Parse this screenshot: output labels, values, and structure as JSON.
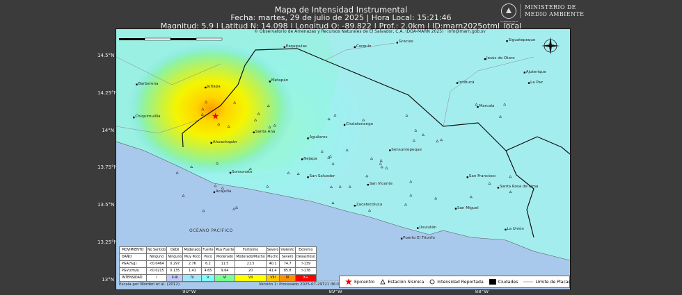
{
  "header": {
    "title": "Mapa de Intensidad Instrumental",
    "line2": "Fecha: martes, 29 de julio de 2025 | Hora Local: 15:21:46",
    "line3": "Magnitud: 5.9 | Latitud N: 14.098 | Longitud O: -89.822 | Prof.: 2.0km | ID:marn2025otml_local"
  },
  "logo": {
    "seal_text": "GOBIERNO DE EL SALVADOR",
    "line1": "MINISTERIO DE",
    "line2": "MEDIO AMBIENTE"
  },
  "map": {
    "copyright": "© Observatorio de Amenazas y Recursos Naturales de El Salvador, C.A. (DOA-MARN 2025) · info@marn.gob.sv",
    "scale_unit": "km",
    "ocean_label": "OCÉANO PACÍFICO",
    "lat_labels": [
      "14.5°N",
      "14.25°N",
      "14°N",
      "13.75°N",
      "13.5°N",
      "13.25°N",
      "13°N"
    ],
    "lon_labels": [
      "90°W",
      "89°W",
      "88°W"
    ],
    "epicenter": {
      "lat": 14.098,
      "lon": -89.822
    },
    "cities": [
      {
        "name": "Esquipulas",
        "lat": 14.56,
        "lon": -89.35
      },
      {
        "name": "Gracias",
        "lat": 14.59,
        "lon": -88.58
      },
      {
        "name": "Siguatepeque",
        "lat": 14.6,
        "lon": -87.83
      },
      {
        "name": "Corquín",
        "lat": 14.56,
        "lon": -88.87
      },
      {
        "name": "Jesús de Otoro",
        "lat": 14.48,
        "lon": -87.98
      },
      {
        "name": "Ajuterique",
        "lat": 14.39,
        "lon": -87.71
      },
      {
        "name": "La Paz",
        "lat": 14.32,
        "lon": -87.68
      },
      {
        "name": "Intibucá",
        "lat": 14.32,
        "lon": -88.17
      },
      {
        "name": "Barberena",
        "lat": 14.31,
        "lon": -90.36
      },
      {
        "name": "Jutiapa",
        "lat": 14.29,
        "lon": -89.89
      },
      {
        "name": "Metapán",
        "lat": 14.33,
        "lon": -89.45
      },
      {
        "name": "Marcala",
        "lat": 14.16,
        "lon": -88.03
      },
      {
        "name": "Chiquimulilla",
        "lat": 14.09,
        "lon": -90.38
      },
      {
        "name": "Chalatenango",
        "lat": 14.04,
        "lon": -88.94
      },
      {
        "name": "Santa Ana",
        "lat": 13.99,
        "lon": -89.56
      },
      {
        "name": "Aguilares",
        "lat": 13.95,
        "lon": -89.19
      },
      {
        "name": "Ahuachapán",
        "lat": 13.92,
        "lon": -89.85
      },
      {
        "name": "Sensuntepeque",
        "lat": 13.87,
        "lon": -88.63
      },
      {
        "name": "Nejapa",
        "lat": 13.81,
        "lon": -89.23
      },
      {
        "name": "Sonsonate",
        "lat": 13.72,
        "lon": -89.72
      },
      {
        "name": "San Salvador",
        "lat": 13.69,
        "lon": -89.19
      },
      {
        "name": "San Francisco",
        "lat": 13.69,
        "lon": -88.1
      },
      {
        "name": "San Vicente",
        "lat": 13.64,
        "lon": -88.78
      },
      {
        "name": "Santa Rosa de Lima",
        "lat": 13.62,
        "lon": -87.89
      },
      {
        "name": "Acajutla",
        "lat": 13.59,
        "lon": -89.83
      },
      {
        "name": "Zacatecoluca",
        "lat": 13.5,
        "lon": -88.87
      },
      {
        "name": "San Miguel",
        "lat": 13.48,
        "lon": -88.18
      },
      {
        "name": "Usulután",
        "lat": 13.35,
        "lon": -88.44
      },
      {
        "name": "La Unión",
        "lat": 13.34,
        "lon": -87.84
      },
      {
        "name": "Puerto El Triunfo",
        "lat": 13.28,
        "lon": -88.55
      }
    ]
  },
  "table": {
    "rows": [
      [
        "MOVIMIENTO",
        "No Sentido",
        "Débil",
        "Moderado",
        "Fuerte",
        "Muy Fuerte",
        "Fortísimo",
        "Severo",
        "Violento",
        "Extremo"
      ],
      [
        "DAÑO",
        "Ninguno",
        "Ninguno",
        "Muy Poco",
        "Poco",
        "Moderado",
        "Moderado/Mucho",
        "Mucho",
        "Severo",
        "Desastroso"
      ],
      [
        "PGA(%g)",
        "<0.0464",
        "0.297",
        "2.76",
        "6.2",
        "11.5",
        "21.5",
        "40.1",
        "74.7",
        ">139"
      ],
      [
        "PGV(cm/s)",
        "<0.0215",
        "0.135",
        "1.41",
        "4.65",
        "9.64",
        "20",
        "41.4",
        "85.8",
        ">178"
      ],
      [
        "INTENSIDAD",
        "I",
        "II-III",
        "IV",
        "V",
        "VI",
        "VII",
        "VIII",
        "IX",
        "X+"
      ]
    ],
    "colors": [
      "#ffffff",
      "#bfccff",
      "#a0e6ff",
      "#80ffff",
      "#7aff93",
      "#ffff00",
      "#ffc800",
      "#ff9100",
      "#ff0000",
      "#c80000"
    ]
  },
  "notes": {
    "scale": "Escala por Worden et al. (2012)",
    "version": "Versión 1: Procesado 2025-07-29T21:36:02Z"
  },
  "legend": {
    "epicenter": "Epicentro",
    "station": "Estación Sísmica",
    "reported": "Intensidad Reportada",
    "cities": "Ciudades",
    "plates": "Límite de Placas"
  }
}
